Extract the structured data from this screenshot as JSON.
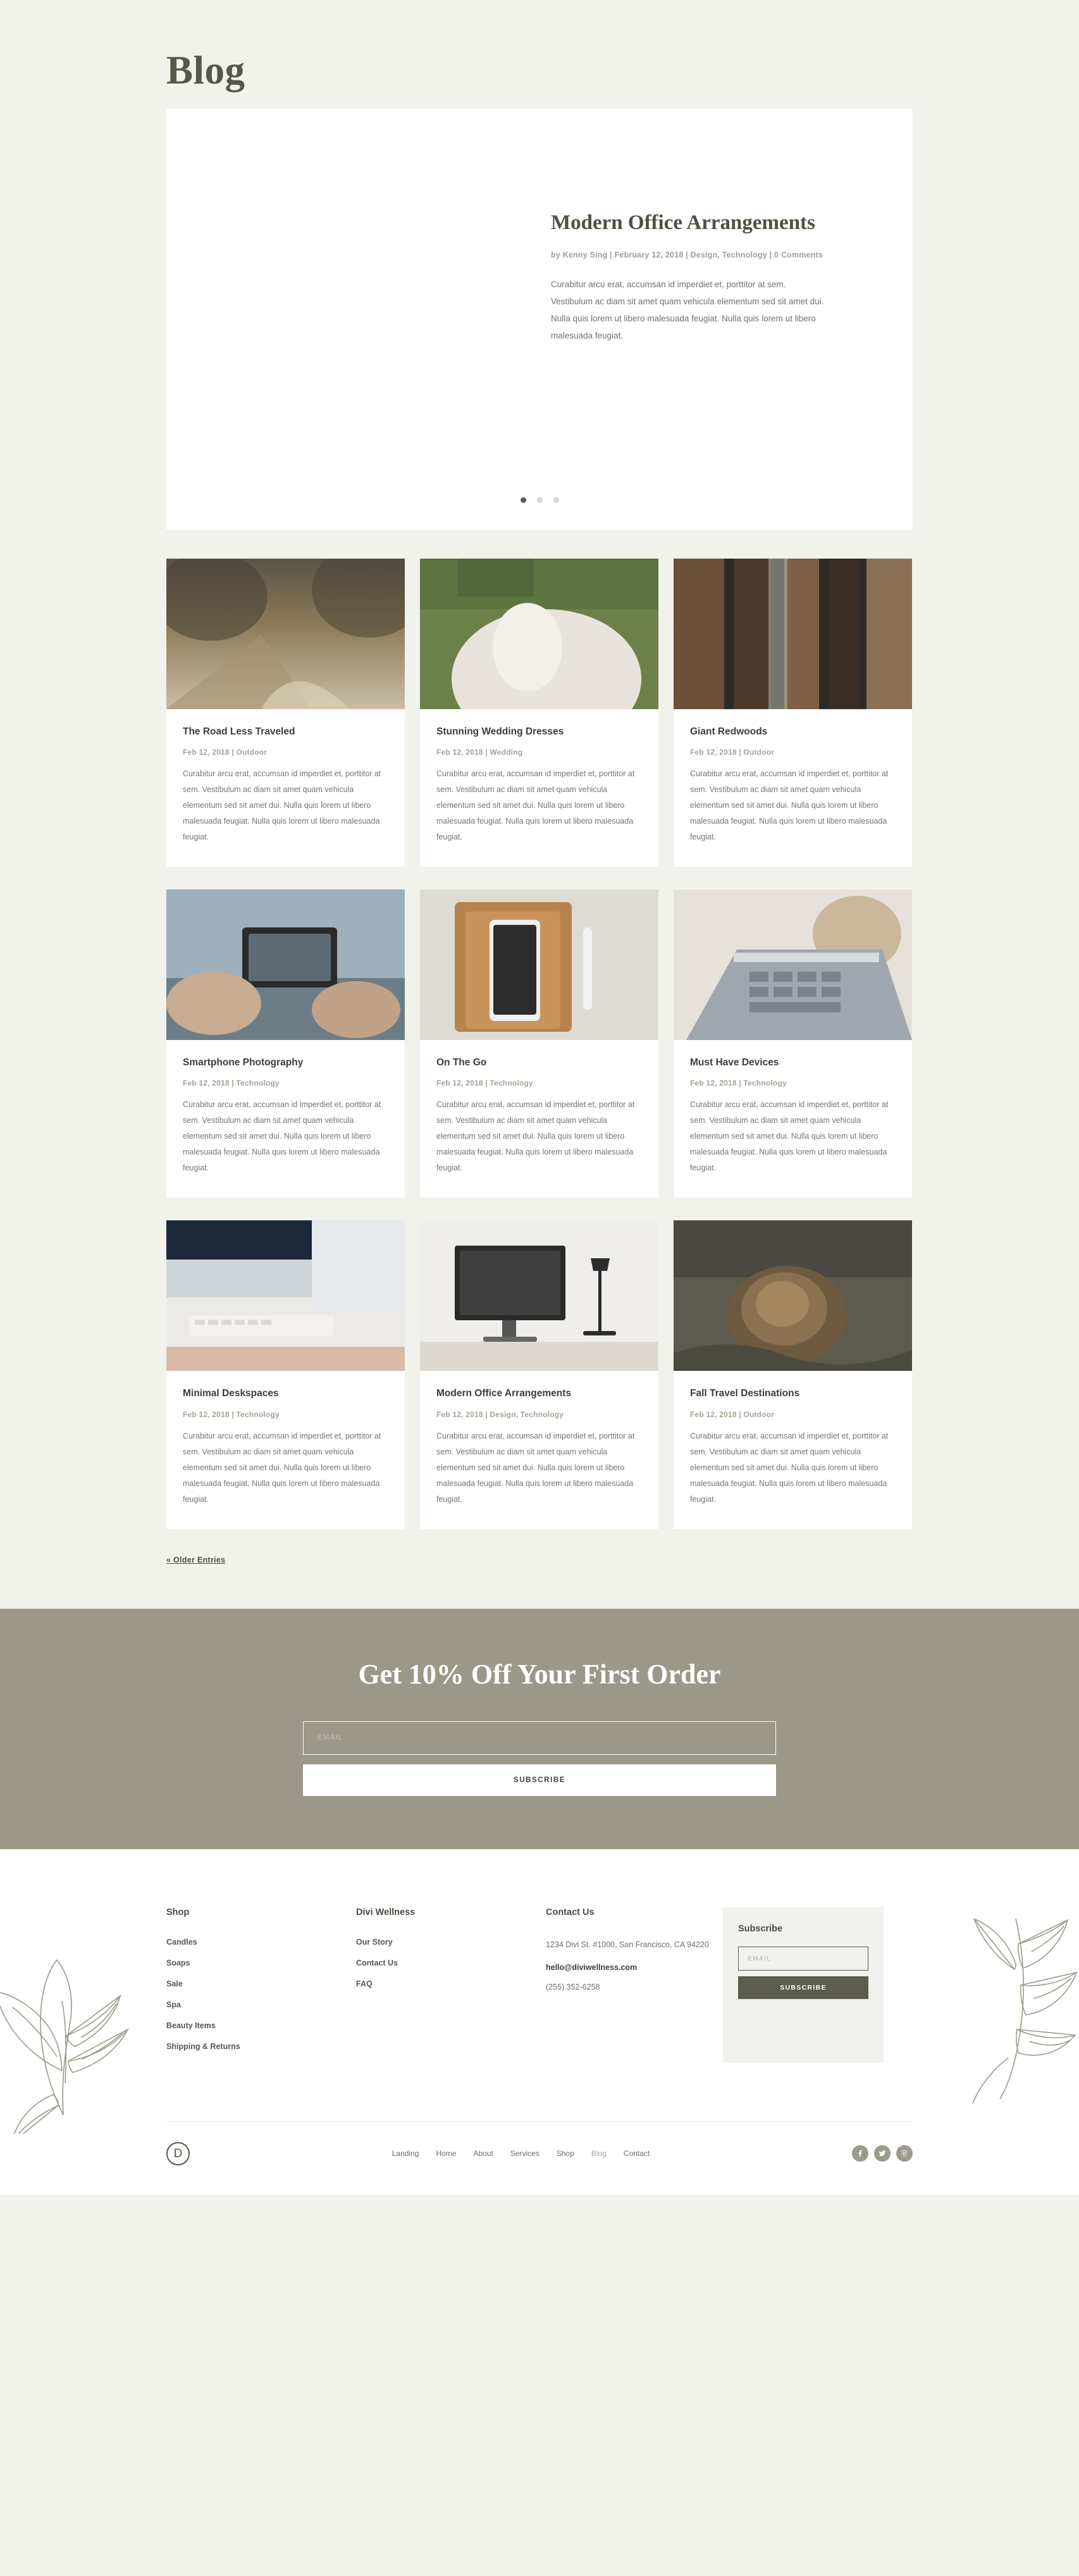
{
  "page": {
    "title": "Blog"
  },
  "hero": {
    "heading": "Modern Office Arrangements",
    "meta": "by Kenny Sing | February 12, 2018 | Design, Technology | 0 Comments",
    "excerpt": "Curabitur arcu erat, accumsan id imperdiet et, porttitor at sem. Vestibulum ac diam sit amet quam vehicula elementum sed sit amet dui. Nulla quis lorem ut libero malesuada feugiat. Nulla quis lorem ut libero malesuada feugiat.",
    "dots": [
      {
        "label": "slide-1",
        "active": true
      },
      {
        "label": "slide-2",
        "active": false
      },
      {
        "label": "slide-3",
        "active": false
      }
    ]
  },
  "posts": [
    {
      "title": "The Road Less Traveled",
      "meta": "Feb 12, 2018 | Outdoor",
      "excerpt": "Curabitur arcu erat, accumsan id imperdiet et, porttitor at sem. Vestibulum ac diam sit amet quam vehicula elementum sed sit amet dui. Nulla quis lorem ut libero malesuada feugiat. Nulla quis lorem ut libero malesuada feugiat.",
      "image": "forest-road"
    },
    {
      "title": "Stunning Wedding Dresses",
      "meta": "Feb 12, 2018 | Wedding",
      "excerpt": "Curabitur arcu erat, accumsan id imperdiet et, porttitor at sem. Vestibulum ac diam sit amet quam vehicula elementum sed sit amet dui. Nulla quis lorem ut libero malesuada feugiat. Nulla quis lorem ut libero malesuada feugiat.",
      "image": "wedding-dress"
    },
    {
      "title": "Giant Redwoods",
      "meta": "Feb 12, 2018 | Outdoor",
      "excerpt": "Curabitur arcu erat, accumsan id imperdiet et, porttitor at sem. Vestibulum ac diam sit amet quam vehicula elementum sed sit amet dui. Nulla quis lorem ut libero malesuada feugiat. Nulla quis lorem ut libero malesuada feugiat.",
      "image": "redwood-trees"
    },
    {
      "title": "Smartphone Photography",
      "meta": "Feb 12, 2018 | Technology",
      "excerpt": "Curabitur arcu erat, accumsan id imperdiet et, porttitor at sem. Vestibulum ac diam sit amet quam vehicula elementum sed sit amet dui. Nulla quis lorem ut libero malesuada feugiat. Nulla quis lorem ut libero malesuada feugiat.",
      "image": "hands-phone"
    },
    {
      "title": "On The Go",
      "meta": "Feb 12, 2018 | Technology",
      "excerpt": "Curabitur arcu erat, accumsan id imperdiet et, porttitor at sem. Vestibulum ac diam sit amet quam vehicula elementum sed sit amet dui. Nulla quis lorem ut libero malesuada feugiat. Nulla quis lorem ut libero malesuada feugiat.",
      "image": "notebook-phone"
    },
    {
      "title": "Must Have Devices",
      "meta": "Feb 12, 2018 | Technology",
      "excerpt": "Curabitur arcu erat, accumsan id imperdiet et, porttitor at sem. Vestibulum ac diam sit amet quam vehicula elementum sed sit amet dui. Nulla quis lorem ut libero malesuada feugiat. Nulla quis lorem ut libero malesuada feugiat.",
      "image": "laptop-keyboard"
    },
    {
      "title": "Minimal Deskspaces",
      "meta": "Feb 12, 2018 | Technology",
      "excerpt": "Curabitur arcu erat, accumsan id imperdiet et, porttitor at sem. Vestibulum ac diam sit amet quam vehicula elementum sed sit amet dui. Nulla quis lorem ut libero malesuada feugiat. Nulla quis lorem ut libero malesuada feugiat.",
      "image": "white-desk"
    },
    {
      "title": "Modern Office Arrangements",
      "meta": "Feb 12, 2018 | Design, Technology",
      "excerpt": "Curabitur arcu erat, accumsan id imperdiet et, porttitor at sem. Vestibulum ac diam sit amet quam vehicula elementum sed sit amet dui. Nulla quis lorem ut libero malesuada feugiat. Nulla quis lorem ut libero malesuada feugiat.",
      "image": "monitor-lamp"
    },
    {
      "title": "Fall Travel Destinations",
      "meta": "Feb 12, 2018 | Outdoor",
      "excerpt": "Curabitur arcu erat, accumsan id imperdiet et, porttitor at sem. Vestibulum ac diam sit amet quam vehicula elementum sed sit amet dui. Nulla quis lorem ut libero malesuada feugiat. Nulla quis lorem ut libero malesuada feugiat.",
      "image": "pine-cone"
    }
  ],
  "pagination": {
    "older_label": "« Older Entries"
  },
  "cta": {
    "heading": "Get 10% Off Your First Order",
    "email_placeholder": "EMAIL",
    "email_value": "",
    "button_label": "SUBSCRIBE",
    "background": "#9c9887"
  },
  "footer": {
    "columns": [
      {
        "heading": "Shop",
        "items": [
          "Candles",
          "Soaps",
          "Sale",
          "Spa",
          "Beauty Items",
          "Shipping & Returns"
        ]
      },
      {
        "heading": "Divi Wellness",
        "items": [
          "Our Story",
          "Contact Us",
          "FAQ"
        ]
      }
    ],
    "contact": {
      "heading": "Contact Us",
      "address": "1234 Divi St. #1000, San Francisco, CA 94220",
      "email": "hello@diviwellness.com",
      "phone": "(255) 352-6258"
    },
    "subscribe": {
      "heading": "Subscribe",
      "email_placeholder": "EMAIL",
      "email_value": "",
      "button_label": "SUBSCRIBE",
      "button_color": "#5c5d4c"
    },
    "logo": {
      "letter": "D"
    },
    "nav": [
      {
        "label": "Landing",
        "active": false
      },
      {
        "label": "Home",
        "active": false
      },
      {
        "label": "About",
        "active": false
      },
      {
        "label": "Services",
        "active": false
      },
      {
        "label": "Shop",
        "active": false
      },
      {
        "label": "Blog",
        "active": true
      },
      {
        "label": "Contact",
        "active": false
      }
    ],
    "socials": [
      "facebook-icon",
      "twitter-icon",
      "instagram-icon"
    ]
  }
}
